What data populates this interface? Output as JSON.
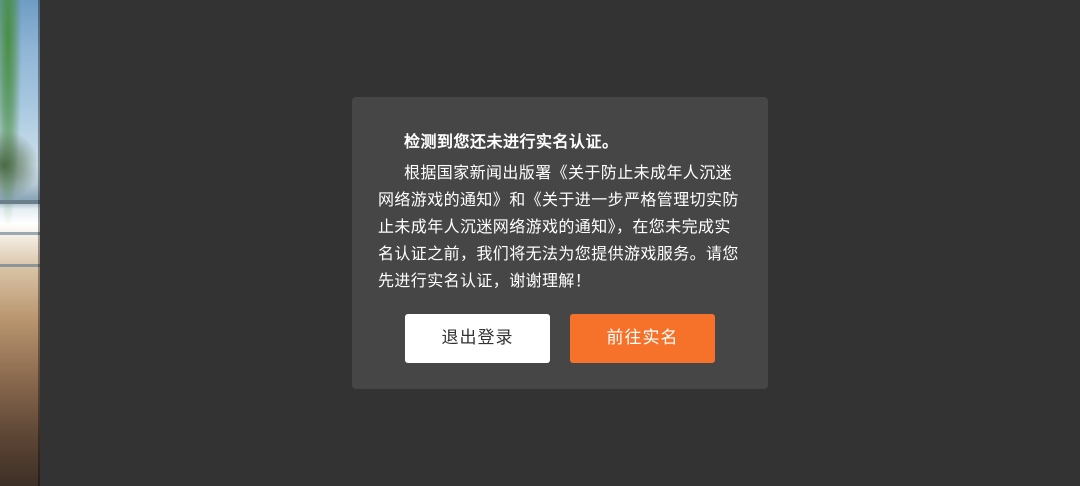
{
  "dialog": {
    "title": "检测到您还未进行实名认证。",
    "body": "根据国家新闻出版署《关于防止未成年人沉迷网络游戏的通知》和《关于进一步严格管理切实防止未成年人沉迷网络游戏的通知》，在您未完成实名认证之前，我们将无法为您提供游戏服务。请您先进行实名认证，谢谢理解！",
    "buttons": {
      "logout": "退出登录",
      "verify": "前往实名"
    }
  },
  "colors": {
    "background": "#333333",
    "dialog": "#464646",
    "accent": "#f6722a",
    "logout_button": "#ffffff"
  }
}
